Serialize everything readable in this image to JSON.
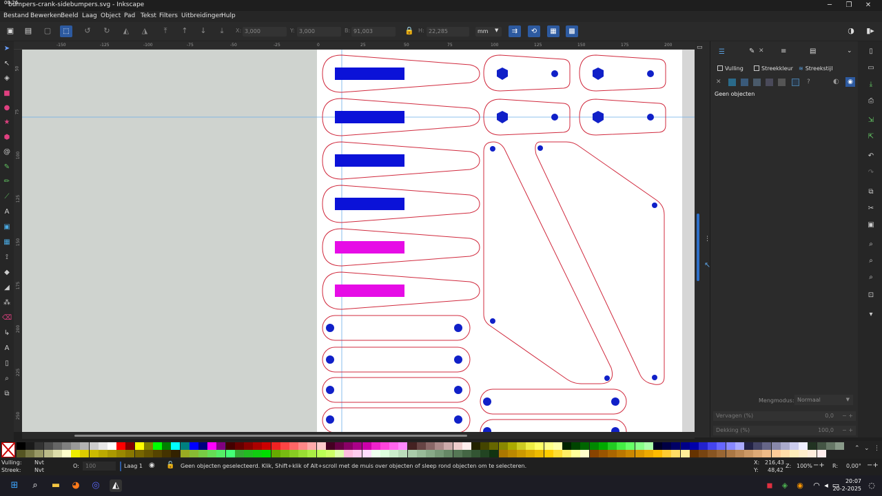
{
  "window": {
    "rec_time": "00:26",
    "title": "bumpers-crank-sidebumpers.svg - Inkscape",
    "minimize": "─",
    "maximize": "❐",
    "close": "✕"
  },
  "menu": [
    "Bestand",
    "Bewerken",
    "Beeld",
    "Laag",
    "Object",
    "Pad",
    "Tekst",
    "Filters",
    "Uitbreidingen",
    "Hulp"
  ],
  "toolbar": {
    "x_label": "X:",
    "x_value": "3,000",
    "y_label": "Y:",
    "y_value": "3,000",
    "w_label": "B:",
    "w_value": "91,003",
    "h_label": "H:",
    "h_value": "22,285",
    "unit": "mm"
  },
  "ruler_top_ticks": [
    "-150",
    "-125",
    "-100",
    "-75",
    "-50",
    "-25",
    "0",
    "25",
    "50",
    "75",
    "100",
    "125",
    "150",
    "175",
    "200"
  ],
  "ruler_left_ticks": [
    "50",
    "75",
    "100",
    "125",
    "150",
    "175",
    "200",
    "225",
    "250"
  ],
  "panel": {
    "tabs": [
      "Vulling",
      "Streekkleur",
      "Streekstijl"
    ],
    "no_objects": "Geen objecten",
    "blend_label": "Mengmodus:",
    "blend_value": "Normaal",
    "blur_label": "Vervagen (%)",
    "blur_value": "0,0",
    "opacity_label": "Dekking (%)",
    "opacity_value": "100,0"
  },
  "status": {
    "fill_label": "Vulling:",
    "fill_value": "Nvt",
    "stroke_label": "Streek:",
    "stroke_value": "Nvt",
    "o_label": "O:",
    "o_value": "100",
    "layer": "Laag 1",
    "message": "Geen objecten geselecteerd. Klik, Shift+klik of Alt+scroll met de muis over objecten of sleep rond objecten om te selecteren.",
    "x_label": "X:",
    "x_value": "216,43",
    "y_label": "Y:",
    "y_value": "48,42",
    "zoom_label": "Z:",
    "zoom_value": "100%",
    "rot_label": "R:",
    "rot_value": "0,00°"
  },
  "clock": {
    "time": "20:07",
    "date": "20-2-2025"
  },
  "colors": {
    "accent": "#2d5aa0",
    "outline": "#d0283c",
    "blue_fill": "#0b12d8",
    "magenta_fill": "#e60ce6",
    "dot_fill": "#1020c8"
  }
}
